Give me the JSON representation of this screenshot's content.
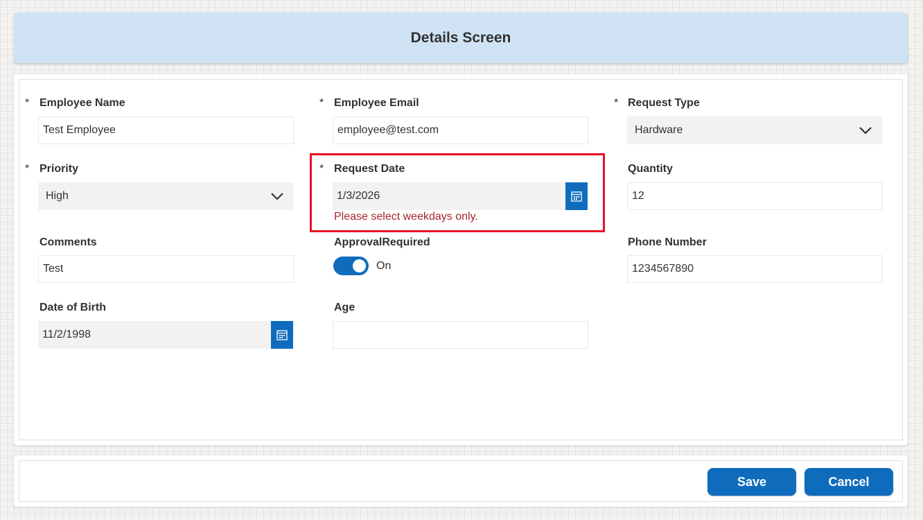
{
  "header": {
    "title": "Details Screen"
  },
  "fields": {
    "employee_name": {
      "label": "Employee Name",
      "required": "*",
      "value": "Test Employee"
    },
    "employee_email": {
      "label": "Employee Email",
      "required": "*",
      "value": "employee@test.com"
    },
    "request_type": {
      "label": "Request Type",
      "required": "*",
      "value": "Hardware"
    },
    "priority": {
      "label": "Priority",
      "required": "*",
      "value": "High"
    },
    "request_date": {
      "label": "Request Date",
      "required": "*",
      "value": "1/3/2026",
      "error": "Please select weekdays only."
    },
    "quantity": {
      "label": "Quantity",
      "value": "12"
    },
    "comments": {
      "label": "Comments",
      "value": "Test"
    },
    "approval_required": {
      "label": "ApprovalRequired",
      "state_text": "On"
    },
    "phone_number": {
      "label": "Phone Number",
      "value": "1234567890"
    },
    "date_of_birth": {
      "label": "Date of Birth",
      "value": "11/2/1998"
    },
    "age": {
      "label": "Age",
      "value": ""
    }
  },
  "footer": {
    "save_label": "Save",
    "cancel_label": "Cancel"
  },
  "colors": {
    "accent": "#0f6cbd",
    "error": "#a4262c",
    "highlight": "#e81123",
    "header_bg": "#cfe3f5"
  },
  "icons": {
    "calendar": "calendar-icon",
    "dropdown": "chevron-down-icon"
  }
}
